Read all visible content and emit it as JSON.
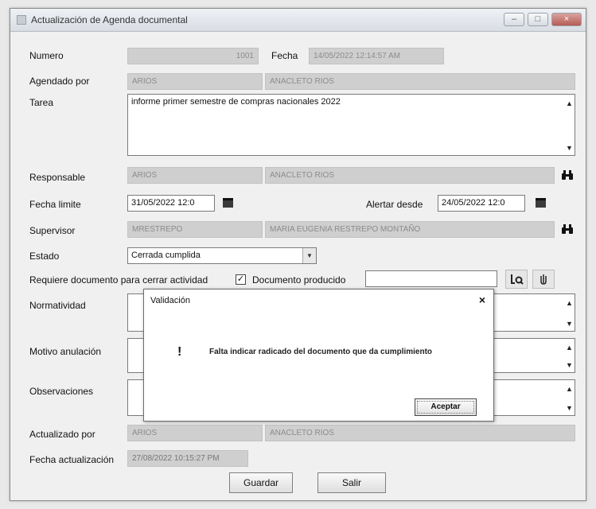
{
  "window": {
    "title": "Actualización de Agenda documental"
  },
  "form": {
    "numero_label": "Numero",
    "numero_value": "1001",
    "fecha_label": "Fecha",
    "fecha_value": "14/05/2022 12:14:57 AM",
    "agendado_label": "Agendado por",
    "agendado_user": "ARIOS",
    "agendado_name": "ANACLETO RIOS",
    "tarea_label": "Tarea",
    "tarea_value": "informe primer semestre de compras nacionales 2022",
    "responsable_label": "Responsable",
    "responsable_user": "ARIOS",
    "responsable_name": "ANACLETO RIOS",
    "fecha_limite_label": "Fecha limite",
    "fecha_limite_value": "31/05/2022 12:0",
    "alertar_label": "Alertar desde",
    "alertar_value": "24/05/2022 12:0",
    "supervisor_label": "Supervisor",
    "supervisor_user": "MRESTREPO",
    "supervisor_name": "MARIA EUGENIA RESTREPO MONTAÑO",
    "estado_label": "Estado",
    "estado_value": "Cerrada cumplida",
    "requiere_label": "Requiere documento para cerrar actividad",
    "requiere_checked": "✓",
    "doc_producido_label": "Documento producido",
    "doc_producido_value": "",
    "normatividad_label": "Normatividad",
    "motivo_label": "Motivo anulación",
    "observaciones_label": "Observaciones",
    "actualizado_label": "Actualizado por",
    "actualizado_user": "ARIOS",
    "actualizado_name": "ANACLETO RIOS",
    "fecha_act_label": "Fecha actualización",
    "fecha_act_value": "27/08/2022 10:15:27 PM",
    "guardar_label": "Guardar",
    "salir_label": "Salir"
  },
  "dialog": {
    "title": "Validación",
    "close": "×",
    "icon": "!",
    "message": "Falta indicar radicado del documento que da cumplimiento",
    "accept_label": "Aceptar"
  },
  "icons": {
    "binoculars": "binoculars-icon",
    "calendar": "calendar-icon",
    "search_doc": "document-search-icon",
    "attach": "attach-icon"
  }
}
